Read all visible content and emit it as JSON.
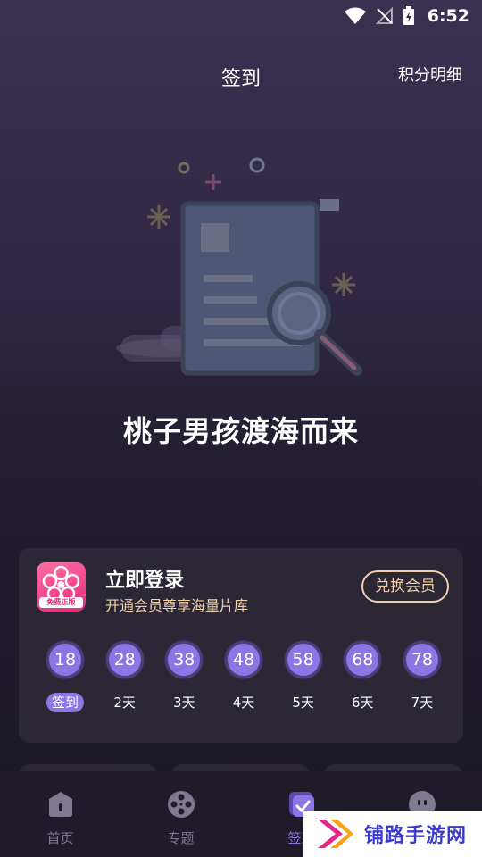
{
  "status_bar": {
    "time": "6:52"
  },
  "header": {
    "title": "签到",
    "points_detail": "积分明细"
  },
  "promo": {
    "text": "桃子男孩渡海而来"
  },
  "card": {
    "app_icon_ribbon": "免费正版",
    "title": "立即登录",
    "subtitle": "开通会员尊享海量片库",
    "redeem_button": "兑换会员",
    "days": [
      {
        "points": "18",
        "label": "签到"
      },
      {
        "points": "28",
        "label": "2天"
      },
      {
        "points": "38",
        "label": "3天"
      },
      {
        "points": "48",
        "label": "4天"
      },
      {
        "points": "58",
        "label": "5天"
      },
      {
        "points": "68",
        "label": "6天"
      },
      {
        "points": "78",
        "label": "7天"
      }
    ]
  },
  "bottom_nav": {
    "items": [
      {
        "label": "首页",
        "icon": "home-icon"
      },
      {
        "label": "专题",
        "icon": "film-reel-icon"
      },
      {
        "label": "签到",
        "icon": "check-in-icon"
      },
      {
        "label": "",
        "icon": "face-icon"
      }
    ]
  },
  "watermark": {
    "text": "铺路手游网"
  },
  "colors": {
    "accent": "#8e75e6",
    "gold": "#f0cfa8",
    "card": "#2b2735"
  }
}
